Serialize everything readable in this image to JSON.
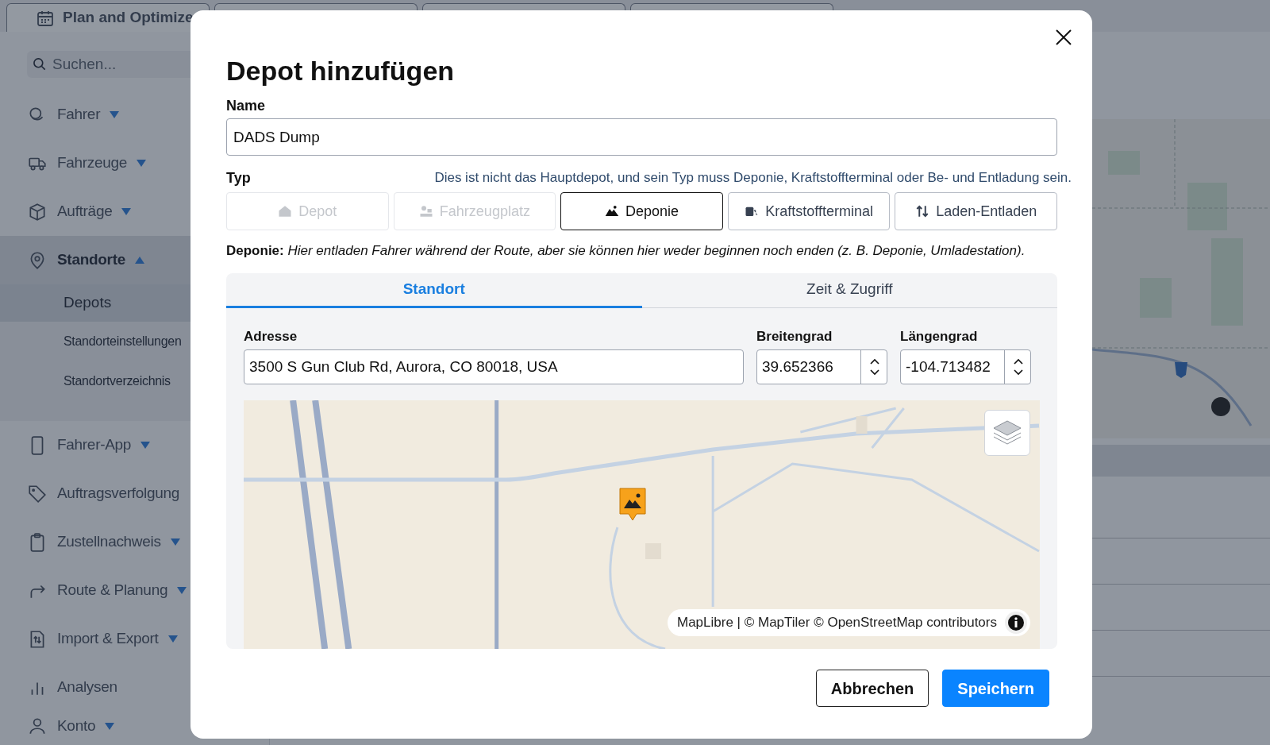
{
  "app_tab": {
    "label": "Plan and Optimize"
  },
  "search": {
    "placeholder": "Suchen..."
  },
  "sidebar": {
    "items": [
      {
        "label": "Fahrer",
        "expanded": false,
        "selected": false
      },
      {
        "label": "Fahrzeuge",
        "expanded": false,
        "selected": false
      },
      {
        "label": "Aufträge",
        "expanded": false,
        "selected": false
      },
      {
        "label": "Standorte",
        "expanded": true,
        "selected": true,
        "children": [
          {
            "label": "Depots",
            "selected": true
          },
          {
            "label": "Standorteinstellungen",
            "selected": false
          },
          {
            "label": "Standortverzeichnis",
            "selected": false
          }
        ]
      },
      {
        "label": "Fahrer-App",
        "expanded": false,
        "selected": false
      },
      {
        "label": "Auftragsverfolgung",
        "selected": false
      },
      {
        "label": "Zustellnachweis",
        "expanded": false,
        "selected": false
      },
      {
        "label": "Route & Planung",
        "expanded": false,
        "selected": false
      },
      {
        "label": "Import & Export",
        "expanded": false,
        "selected": false
      },
      {
        "label": "Analysen",
        "selected": false
      },
      {
        "label": "Konto",
        "expanded": false,
        "selected": false
      }
    ]
  },
  "dialog": {
    "title": "Depot hinzufügen",
    "name": {
      "label": "Name",
      "value": "DADS Dump"
    },
    "type": {
      "label": "Typ",
      "hint": "Dies ist nicht das Hauptdepot, und sein Typ muss Deponie, Kraftstoffterminal oder Be- und Entladung sein.",
      "options": [
        {
          "label": "Depot",
          "disabled": true,
          "selected": false
        },
        {
          "label": "Fahrzeugplatz",
          "disabled": true,
          "selected": false
        },
        {
          "label": "Deponie",
          "disabled": false,
          "selected": true
        },
        {
          "label": "Kraftstoffterminal",
          "disabled": false,
          "selected": false
        },
        {
          "label": "Laden-Entladen",
          "disabled": false,
          "selected": false
        }
      ],
      "description": "**Deponie:** *Hier entladen Fahrer während der Route, aber sie können hier weder beginnen noch enden (z. B. Deponie, Umladestation).*"
    },
    "tabs": [
      {
        "label": "Standort",
        "selected": true
      },
      {
        "label": "Zeit & Zugriff",
        "selected": false
      }
    ],
    "address": {
      "label": "Adresse",
      "value": "3500 S Gun Club Rd, Aurora, CO 80018, USA"
    },
    "latitude": {
      "label": "Breitengrad",
      "value": "39.652366"
    },
    "longitude": {
      "label": "Längengrad",
      "value": "-104.713482"
    },
    "map": {
      "kind": "picture",
      "attribution": "MapLibre | © MapTiler © OpenStreetMap contributors"
    },
    "buttons": [
      {
        "label": "Abbrechen",
        "kind": "secondary"
      },
      {
        "label": "Speichern",
        "kind": "primary"
      }
    ]
  }
}
